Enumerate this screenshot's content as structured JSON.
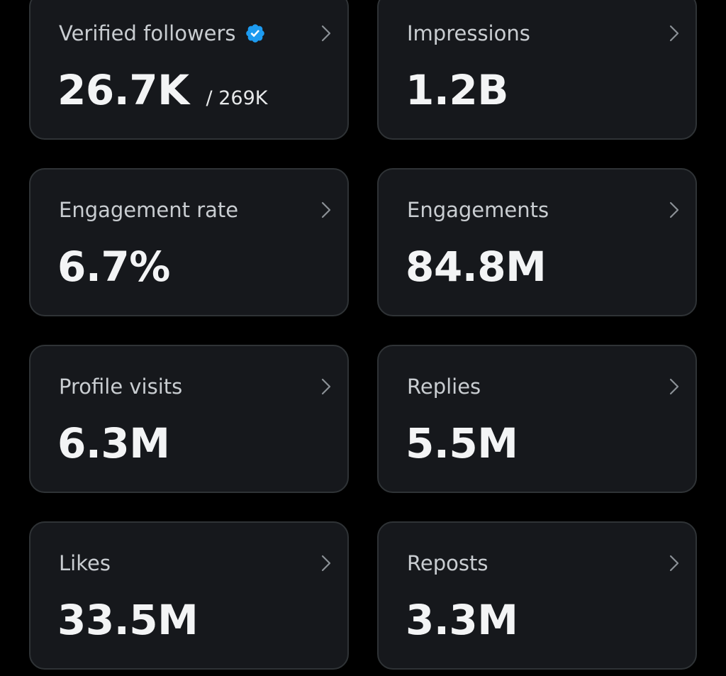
{
  "colors": {
    "background": "#000000",
    "card_background": "#16181c",
    "card_border": "#2f3336",
    "verified_badge": "#1d9bf0",
    "label_text": "#c9cdd1",
    "value_text": "#f3f4f5"
  },
  "cards": [
    {
      "label": "Verified followers",
      "value": "26.7K",
      "sub": "/ 269K",
      "badge_icon": "verified-badge-icon",
      "chevron_icon": "chevron-right-icon"
    },
    {
      "label": "Impressions",
      "value": "1.2B",
      "chevron_icon": "chevron-right-icon"
    },
    {
      "label": "Engagement rate",
      "value": "6.7%",
      "chevron_icon": "chevron-right-icon"
    },
    {
      "label": "Engagements",
      "value": "84.8M",
      "chevron_icon": "chevron-right-icon"
    },
    {
      "label": "Profile visits",
      "value": "6.3M",
      "chevron_icon": "chevron-right-icon"
    },
    {
      "label": "Replies",
      "value": "5.5M",
      "chevron_icon": "chevron-right-icon"
    },
    {
      "label": "Likes",
      "value": "33.5M",
      "chevron_icon": "chevron-right-icon"
    },
    {
      "label": "Reposts",
      "value": "3.3M",
      "chevron_icon": "chevron-right-icon"
    }
  ]
}
